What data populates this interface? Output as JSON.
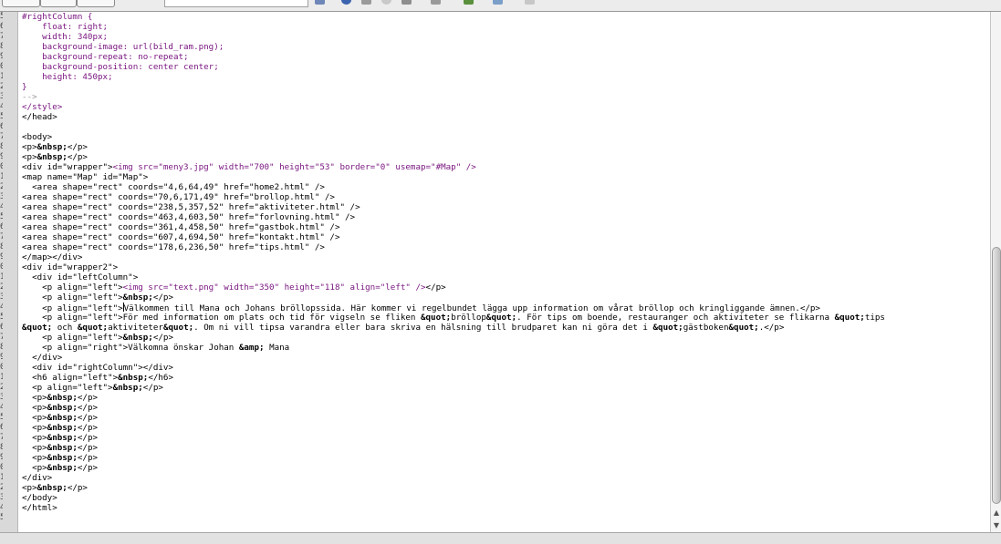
{
  "gutter": {
    "numbers": [
      "5",
      "6",
      "7",
      "8",
      "9",
      "0",
      "1",
      "2",
      "3",
      "4",
      "5",
      "6",
      "7",
      "8",
      "9",
      "0",
      "1",
      "2",
      "3",
      "4",
      "5",
      "6",
      "7",
      "8",
      "9",
      "0",
      "1",
      "2",
      "3",
      "4",
      "5",
      "6",
      "7",
      "8",
      "9",
      "0",
      "1",
      "2",
      "3",
      "4",
      "5",
      "6",
      "7",
      "8",
      "9",
      "0",
      "1",
      "2",
      "3",
      "4",
      "5"
    ]
  },
  "code": {
    "lines": [
      [
        {
          "c": "k",
          "t": "#rightColumn {"
        }
      ],
      [
        {
          "c": "k",
          "t": "    float: right;"
        }
      ],
      [
        {
          "c": "k",
          "t": "    width: 340px;"
        }
      ],
      [
        {
          "c": "k",
          "t": "    background-image: url(bild_ram.png);"
        }
      ],
      [
        {
          "c": "k",
          "t": "    background-repeat: no-repeat;"
        }
      ],
      [
        {
          "c": "k",
          "t": "    background-position: center center;"
        }
      ],
      [
        {
          "c": "k",
          "t": "    height: 450px;"
        }
      ],
      [
        {
          "c": "k",
          "t": "}"
        }
      ],
      [
        {
          "c": "g",
          "t": "-->"
        }
      ],
      [
        {
          "c": "k",
          "t": "</style>"
        }
      ],
      [
        {
          "c": "",
          "t": "</head>"
        }
      ],
      [],
      [
        {
          "c": "",
          "t": "<body>"
        }
      ],
      [
        {
          "c": "",
          "t": "<p>"
        },
        {
          "c": "e",
          "t": "&nbsp;"
        },
        {
          "c": "",
          "t": "</p>"
        }
      ],
      [
        {
          "c": "",
          "t": "<p>"
        },
        {
          "c": "e",
          "t": "&nbsp;"
        },
        {
          "c": "",
          "t": "</p>"
        }
      ],
      [
        {
          "c": "",
          "t": "<div id=\"wrapper\">"
        },
        {
          "c": "k",
          "t": "<img src=\"meny3.jpg\" width=\"700\" height=\"53\" border=\"0\" usemap=\"#Map\" />"
        }
      ],
      [
        {
          "c": "",
          "t": "<map name=\"Map\" id=\"Map\">"
        }
      ],
      [
        {
          "c": "",
          "t": "  <area shape=\"rect\" coords=\"4,6,64,49\" href=\"home2.html\" />"
        }
      ],
      [
        {
          "c": "",
          "t": "<area shape=\"rect\" coords=\"70,6,171,49\" href=\"brollop.html\" />"
        }
      ],
      [
        {
          "c": "",
          "t": "<area shape=\"rect\" coords=\"238,5,357,52\" href=\"aktiviteter.html\" />"
        }
      ],
      [
        {
          "c": "",
          "t": "<area shape=\"rect\" coords=\"463,4,603,50\" href=\"forlovning.html\" />"
        }
      ],
      [
        {
          "c": "",
          "t": "<area shape=\"rect\" coords=\"361,4,458,50\" href=\"gastbok.html\" />"
        }
      ],
      [
        {
          "c": "",
          "t": "<area shape=\"rect\" coords=\"607,4,694,50\" href=\"kontakt.html\" />"
        }
      ],
      [
        {
          "c": "",
          "t": "<area shape=\"rect\" coords=\"178,6,236,50\" href=\"tips.html\" />"
        }
      ],
      [
        {
          "c": "",
          "t": "</map></div>"
        }
      ],
      [
        {
          "c": "",
          "t": "<div id=\"wrapper2\">"
        }
      ],
      [
        {
          "c": "",
          "t": "  <div id=\"leftColumn\">"
        }
      ],
      [
        {
          "c": "",
          "t": "    <p align=\"left\">"
        },
        {
          "c": "k",
          "t": "<img src=\"text.png\" width=\"350\" height=\"118\" align=\"left\" />"
        },
        {
          "c": "",
          "t": "</p>"
        }
      ],
      [
        {
          "c": "",
          "t": "    <p align=\"left\">"
        },
        {
          "c": "e",
          "t": "&nbsp;"
        },
        {
          "c": "",
          "t": "</p>"
        }
      ],
      [
        {
          "c": "",
          "t": "    <p align=\"left\">"
        },
        {
          "c": "cursor",
          "t": ""
        },
        {
          "c": "",
          "t": "Välkommen till Mana och Johans bröllopssida. Här kommer vi regelbundet lägga upp information om vårat bröllop och kringliggande ämnen.</p>"
        }
      ],
      [
        {
          "c": "",
          "t": "    <p align=\"left\">För med information om plats och tid för vigseln se fliken "
        },
        {
          "c": "e",
          "t": "&quot;"
        },
        {
          "c": "",
          "t": "bröllop"
        },
        {
          "c": "e",
          "t": "&quot;"
        },
        {
          "c": "",
          "t": ". För tips om boende, restauranger och aktiviteter se flikarna "
        },
        {
          "c": "e",
          "t": "&quot;"
        },
        {
          "c": "",
          "t": "tips"
        }
      ],
      [
        {
          "c": "e",
          "t": "&quot;"
        },
        {
          "c": "",
          "t": " och "
        },
        {
          "c": "e",
          "t": "&quot;"
        },
        {
          "c": "",
          "t": "aktiviteter"
        },
        {
          "c": "e",
          "t": "&quot;"
        },
        {
          "c": "",
          "t": ". Om ni vill tipsa varandra eller bara skriva en hälsning till brudparet kan ni göra det i "
        },
        {
          "c": "e",
          "t": "&quot;"
        },
        {
          "c": "",
          "t": "gästboken"
        },
        {
          "c": "e",
          "t": "&quot;"
        },
        {
          "c": "",
          "t": ".</p>"
        }
      ],
      [
        {
          "c": "",
          "t": "    <p align=\"left\">"
        },
        {
          "c": "e",
          "t": "&nbsp;"
        },
        {
          "c": "",
          "t": "</p>"
        }
      ],
      [
        {
          "c": "",
          "t": "    <p align=\"right\">Välkomna önskar Johan "
        },
        {
          "c": "e",
          "t": "&amp;"
        },
        {
          "c": "",
          "t": " Mana"
        }
      ],
      [
        {
          "c": "",
          "t": "  </div>"
        }
      ],
      [
        {
          "c": "",
          "t": "  <div id=\"rightColumn\"></div>"
        }
      ],
      [
        {
          "c": "",
          "t": "  <h6 align=\"left\">"
        },
        {
          "c": "e",
          "t": "&nbsp;"
        },
        {
          "c": "",
          "t": "</h6>"
        }
      ],
      [
        {
          "c": "",
          "t": "  <p align=\"left\">"
        },
        {
          "c": "e",
          "t": "&nbsp;"
        },
        {
          "c": "",
          "t": "</p>"
        }
      ],
      [
        {
          "c": "",
          "t": "  <p>"
        },
        {
          "c": "e",
          "t": "&nbsp;"
        },
        {
          "c": "",
          "t": "</p>"
        }
      ],
      [
        {
          "c": "",
          "t": "  <p>"
        },
        {
          "c": "e",
          "t": "&nbsp;"
        },
        {
          "c": "",
          "t": "</p>"
        }
      ],
      [
        {
          "c": "",
          "t": "  <p>"
        },
        {
          "c": "e",
          "t": "&nbsp;"
        },
        {
          "c": "",
          "t": "</p>"
        }
      ],
      [
        {
          "c": "",
          "t": "  <p>"
        },
        {
          "c": "e",
          "t": "&nbsp;"
        },
        {
          "c": "",
          "t": "</p>"
        }
      ],
      [
        {
          "c": "",
          "t": "  <p>"
        },
        {
          "c": "e",
          "t": "&nbsp;"
        },
        {
          "c": "",
          "t": "</p>"
        }
      ],
      [
        {
          "c": "",
          "t": "  <p>"
        },
        {
          "c": "e",
          "t": "&nbsp;"
        },
        {
          "c": "",
          "t": "</p>"
        }
      ],
      [
        {
          "c": "",
          "t": "  <p>"
        },
        {
          "c": "e",
          "t": "&nbsp;"
        },
        {
          "c": "",
          "t": "</p>"
        }
      ],
      [
        {
          "c": "",
          "t": "  <p>"
        },
        {
          "c": "e",
          "t": "&nbsp;"
        },
        {
          "c": "",
          "t": "</p>"
        }
      ],
      [
        {
          "c": "",
          "t": "</div>"
        }
      ],
      [
        {
          "c": "",
          "t": "<p>"
        },
        {
          "c": "e",
          "t": "&nbsp;"
        },
        {
          "c": "",
          "t": "</p>"
        }
      ],
      [
        {
          "c": "",
          "t": "</body>"
        }
      ],
      [
        {
          "c": "",
          "t": "</html>"
        }
      ]
    ]
  },
  "scrollbar": {
    "up_arrow": "▲",
    "down_arrow": "▼"
  }
}
